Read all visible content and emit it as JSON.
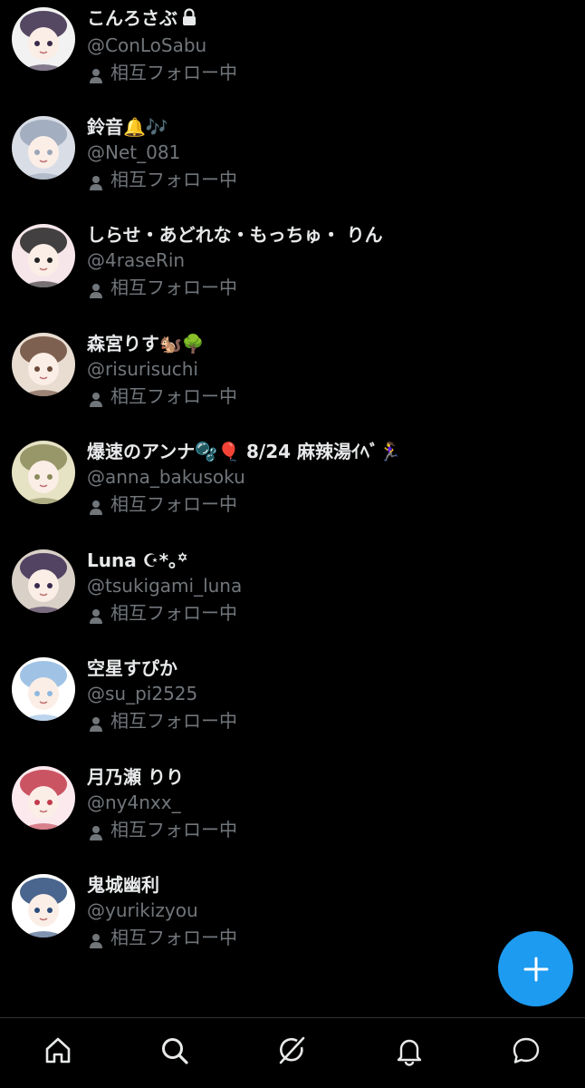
{
  "mutual_label": "相互フォロー中",
  "users": [
    {
      "name": "こんろさぶ",
      "handle": "@ConLoSabu",
      "mutual": "相互フォロー中",
      "locked": true,
      "avatar_bg": "#f2f2f2",
      "avatar_fg": "#3a2a4a"
    },
    {
      "name": "鈴音🔔🎶",
      "handle": "@Net_081",
      "mutual": "相互フォロー中",
      "locked": false,
      "avatar_bg": "#d8dde6",
      "avatar_fg": "#9aa6b8"
    },
    {
      "name": "しらせ・あどれな・もっちゅ・ りん",
      "handle": "@4raseRin",
      "mutual": "相互フォロー中",
      "locked": false,
      "avatar_bg": "#f6e6ea",
      "avatar_fg": "#222222"
    },
    {
      "name": "森宮りす🐿️🌳",
      "handle": "@risurisuchi",
      "mutual": "相互フォロー中",
      "locked": false,
      "avatar_bg": "#e9ddd2",
      "avatar_fg": "#6b4a3a"
    },
    {
      "name": "爆速のアンナ🫧🎈 8/24 麻辣湯ｲﾍﾞ🏃‍♀️",
      "handle": "@anna_bakusoku",
      "mutual": "相互フォロー中",
      "locked": false,
      "avatar_bg": "#e6e2c4",
      "avatar_fg": "#8a8a5a"
    },
    {
      "name": "Luna ☪︎*｡꙳",
      "handle": "@tsukigami_luna",
      "mutual": "相互フォロー中",
      "locked": false,
      "avatar_bg": "#d9d0c8",
      "avatar_fg": "#3a2a50"
    },
    {
      "name": "空星すぴか",
      "handle": "@su_pi2525",
      "mutual": "相互フォロー中",
      "locked": false,
      "avatar_bg": "#ffffff",
      "avatar_fg": "#8fb8e0"
    },
    {
      "name": "月乃瀬 りり",
      "handle": "@ny4nxx_",
      "mutual": "相互フォロー中",
      "locked": false,
      "avatar_bg": "#fbe9ee",
      "avatar_fg": "#c23a4a"
    },
    {
      "name": "鬼城幽利",
      "handle": "@yurikizyou",
      "mutual": "相互フォロー中",
      "locked": false,
      "avatar_bg": "#ffffff",
      "avatar_fg": "#2a4a7a"
    }
  ],
  "tabs": [
    {
      "name": "home"
    },
    {
      "name": "search"
    },
    {
      "name": "grok"
    },
    {
      "name": "notifications"
    },
    {
      "name": "messages"
    }
  ],
  "colors": {
    "background": "#000000",
    "primary_text": "#e7e9ea",
    "secondary_text": "#71767b",
    "accent": "#1d9bf0",
    "divider": "#2f3336"
  }
}
